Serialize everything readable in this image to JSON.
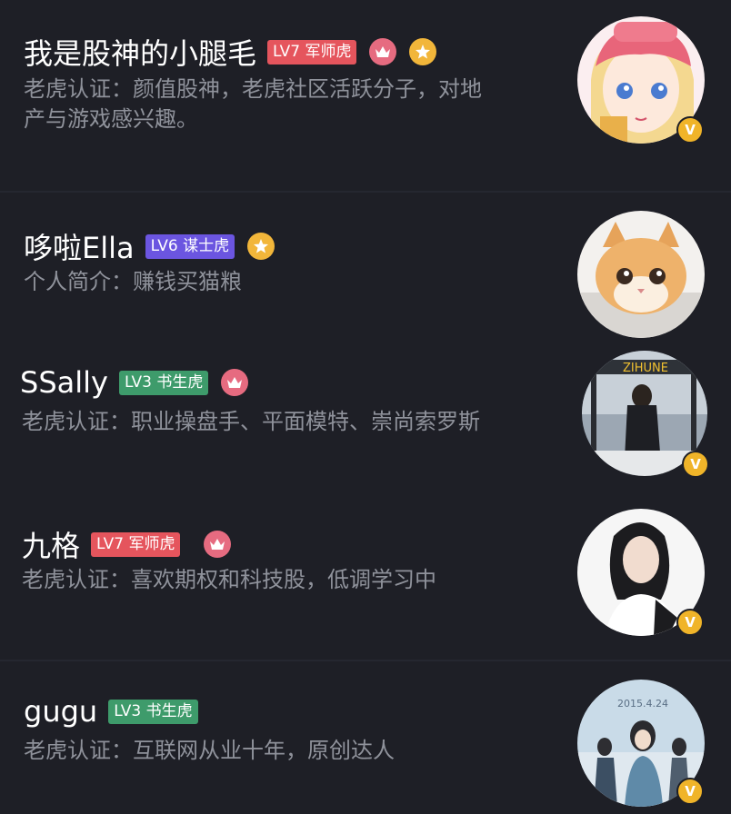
{
  "colors": {
    "background": "#1e1f26",
    "divider": "#252730",
    "text_primary": "#ffffff",
    "text_secondary": "#8f929b",
    "lv7_badge": "#e5555d",
    "lv6_badge": "#6b55e0",
    "lv3_badge": "#3e9b6b",
    "crown_medal": "#e66b80",
    "star_medal": "#f2b63a",
    "verified_badge": "#f0b429"
  },
  "users": [
    {
      "name": "我是股神的小腿毛",
      "level": "LV7 军师虎",
      "level_color": "#e5555d",
      "medals": [
        "crown-icon",
        "star-icon"
      ],
      "description_lines": [
        "老虎认证：颜值股神，老虎社区活跃分子，对地",
        "产与游戏感兴趣。"
      ],
      "avatar": "anime-girl-avatar",
      "verified": true,
      "verified_mark": "V"
    },
    {
      "name": "哆啦Ella",
      "level": "LV6 谋士虎",
      "level_color": "#6b55e0",
      "medals": [
        "star-icon"
      ],
      "description_lines": [
        "个人简介：赚钱买猫粮"
      ],
      "avatar": "cat-avatar",
      "verified": false
    },
    {
      "name": "SSally",
      "level": "LV3 书生虎",
      "level_color": "#3e9b6b",
      "medals": [
        "crown-icon"
      ],
      "description_lines": [
        "老虎认证：职业操盘手、平面模特、崇尚索罗斯"
      ],
      "avatar": "photo-avatar",
      "verified": true,
      "verified_mark": "V"
    },
    {
      "name": "九格",
      "level": "LV7 军师虎",
      "level_color": "#e5555d",
      "medals": [
        "crown-icon"
      ],
      "description_lines": [
        "老虎认证：喜欢期权和科技股，低调学习中"
      ],
      "avatar": "portrait-avatar",
      "verified": true,
      "verified_mark": "V"
    },
    {
      "name": "gugu",
      "level": "LV3 书生虎",
      "level_color": "#3e9b6b",
      "medals": [],
      "description_lines": [
        "老虎认证：互联网从业十年，原创达人"
      ],
      "avatar": "poster-avatar",
      "avatar_caption": "2015.4.24",
      "verified": true,
      "verified_mark": "V"
    }
  ]
}
